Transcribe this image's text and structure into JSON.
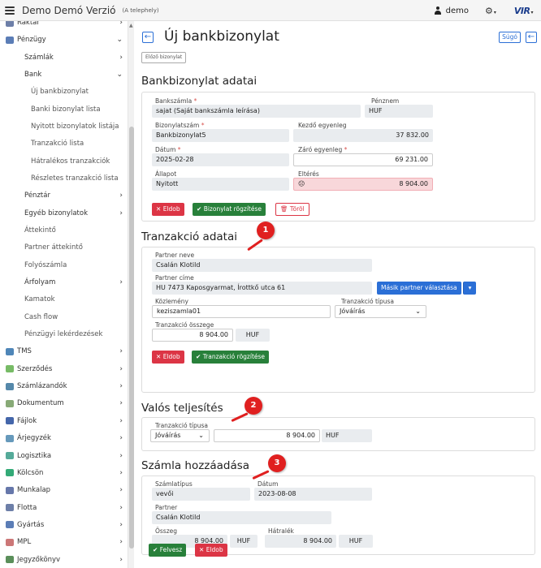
{
  "topbar": {
    "title": "Demo Demó Verzió",
    "subtitle": "(A telephely)",
    "user": "demo",
    "logo": "VIR"
  },
  "sidebar": {
    "items": [
      {
        "label": "Raktár",
        "level": 1,
        "chevron": "›"
      },
      {
        "label": "Pénzügy",
        "level": 1,
        "chevron": "⌄"
      },
      {
        "label": "Számlák",
        "level": 2,
        "chevron": "›"
      },
      {
        "label": "Bank",
        "level": 2,
        "chevron": "⌄"
      },
      {
        "label": "Új bankbizonylat",
        "level": 3
      },
      {
        "label": "Banki bizonylat lista",
        "level": 3
      },
      {
        "label": "Nyitott bizonylatok listája",
        "level": 3
      },
      {
        "label": "Tranzakció lista",
        "level": 3
      },
      {
        "label": "Hátralékos tranzakciók",
        "level": 3
      },
      {
        "label": "Részletes tranzakció lista",
        "level": 3
      },
      {
        "label": "Pénztár",
        "level": 2,
        "chevron": "›"
      },
      {
        "label": "Egyéb bizonylatok",
        "level": 2,
        "chevron": "›"
      },
      {
        "label": "Áttekintő",
        "level": 2
      },
      {
        "label": "Partner áttekintő",
        "level": 2
      },
      {
        "label": "Folyószámla",
        "level": 2
      },
      {
        "label": "Árfolyam",
        "level": 2,
        "chevron": "›"
      },
      {
        "label": "Kamatok",
        "level": 2
      },
      {
        "label": "Cash flow",
        "level": 2
      },
      {
        "label": "Pénzügyi lekérdezések",
        "level": 2
      },
      {
        "label": "TMS",
        "level": 1,
        "chevron": "›"
      },
      {
        "label": "Szerződés",
        "level": 1,
        "chevron": "›"
      },
      {
        "label": "Számlázandók",
        "level": 1,
        "chevron": "›"
      },
      {
        "label": "Dokumentum",
        "level": 1,
        "chevron": "›"
      },
      {
        "label": "Fájlok",
        "level": 1,
        "chevron": "›"
      },
      {
        "label": "Árjegyzék",
        "level": 1,
        "chevron": "›"
      },
      {
        "label": "Logisztika",
        "level": 1,
        "chevron": "›"
      },
      {
        "label": "Kölcsön",
        "level": 1,
        "chevron": "›"
      },
      {
        "label": "Munkalap",
        "level": 1,
        "chevron": "›"
      },
      {
        "label": "Flotta",
        "level": 1,
        "chevron": "›"
      },
      {
        "label": "Gyártás",
        "level": 1,
        "chevron": "›"
      },
      {
        "label": "MPL",
        "level": 1,
        "chevron": "›"
      },
      {
        "label": "Jegyzőkönyv",
        "level": 1,
        "chevron": "›"
      }
    ]
  },
  "header": {
    "back": "←",
    "title": "Új bankbizonylat",
    "help": "Súgó",
    "prev_doc": "Előző bizonylat"
  },
  "bank": {
    "section_title": "Bankbizonylat adatai",
    "account_label": "Bankszámla",
    "account_value": "sajat (Saját bankszámla leírása)",
    "currency_label": "Pénznem",
    "currency_value": "HUF",
    "doc_no_label": "Bizonylatszám",
    "doc_no_value": "Bankbizonylat5",
    "opening_label": "Kezdő egyenleg",
    "opening_value": "37 832.00",
    "date_label": "Dátum",
    "date_value": "2025-02-28",
    "closing_label": "Záró egyenleg",
    "closing_value": "69 231.00",
    "status_label": "Állapot",
    "status_value": "Nyitott",
    "diff_label": "Eltérés",
    "diff_icon": "☹",
    "diff_value": "8 904.00",
    "btn_discard": "Eldob",
    "btn_save": "Bizonylat rögzítése",
    "btn_delete": "Töröl"
  },
  "transaction": {
    "section_title": "Tranzakció adatai",
    "partner_label": "Partner neve",
    "partner_value": "Csalán Klotild",
    "address_label": "Partner címe",
    "address_value": "HU 7473 Kaposgyarmat, Írottkő utca 61",
    "other_partner": "Másik partner választása",
    "note_label": "Közlemény",
    "note_value": "keziszamla01",
    "type_label": "Tranzakció típusa",
    "type_value": "Jóváírás",
    "amount_label": "Tranzakció összege",
    "amount_value": "8 904.00",
    "amount_currency": "HUF",
    "btn_discard": "Eldob",
    "btn_save": "Tranzakció rögzítése"
  },
  "fulfillment": {
    "section_title": "Valós teljesítés",
    "type_label": "Tranzakció típusa",
    "type_value": "Jóváírás",
    "amount_value": "8 904.00",
    "currency": "HUF"
  },
  "invoice": {
    "section_title": "Számla hozzáadása",
    "type_label": "Számlatípus",
    "type_value": "vevői",
    "date_label": "Dátum",
    "date_value": "2023-08-08",
    "partner_label": "Partner",
    "partner_value": "Csalán Klotild",
    "amount_label": "Összeg",
    "amount_value": "8 904.00",
    "amount_currency": "HUF",
    "due_label": "Hátralék",
    "due_value": "8 904.00",
    "due_currency": "HUF"
  },
  "footer": {
    "btn_add": "Felvesz",
    "btn_discard": "Eldob"
  },
  "badges": [
    "1",
    "2",
    "3"
  ],
  "colors": {
    "accent": "#2b6fd6",
    "success": "#28803a",
    "danger": "#dc3545",
    "badge": "#e02020"
  }
}
